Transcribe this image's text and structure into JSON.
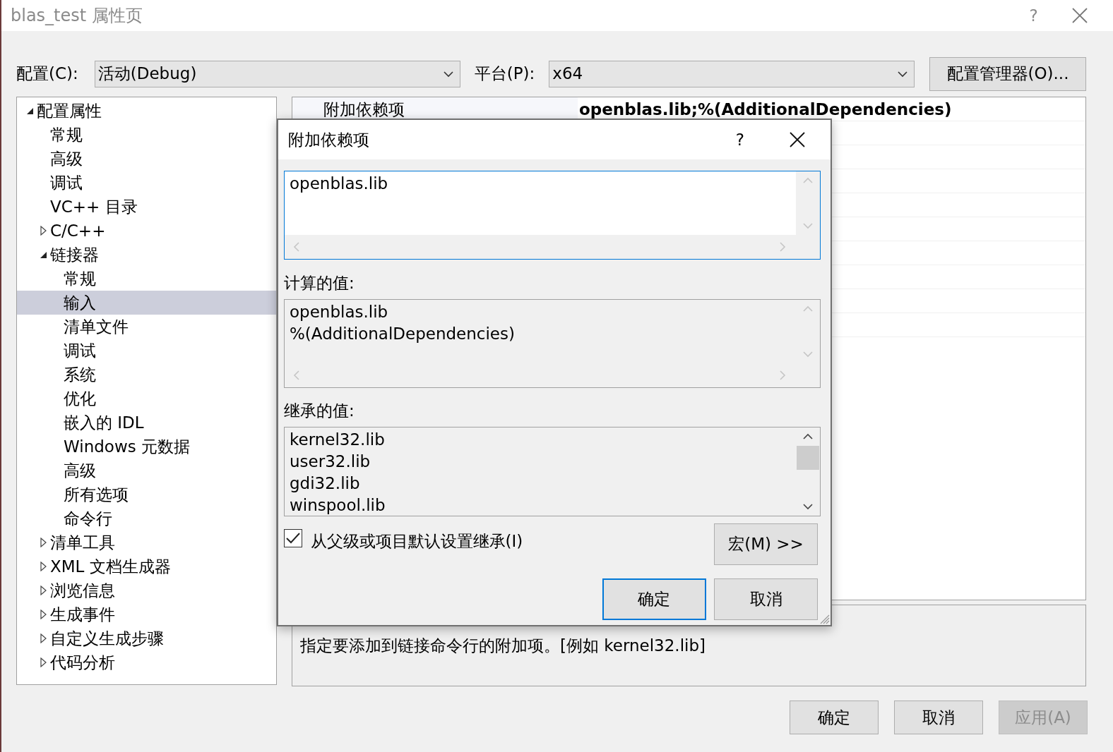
{
  "window": {
    "title": "blas_test 属性页",
    "help": "?"
  },
  "config": {
    "config_label": "配置(C):",
    "config_value": "活动(Debug)",
    "platform_label": "平台(P):",
    "platform_value": "x64",
    "manager_button": "配置管理器(O)..."
  },
  "tree": [
    {
      "label": "配置属性",
      "expanded": true,
      "selected": false,
      "children": [
        {
          "label": "常规",
          "selected": false
        },
        {
          "label": "高级",
          "selected": false
        },
        {
          "label": "调试",
          "selected": false
        },
        {
          "label": "VC++ 目录",
          "selected": false
        },
        {
          "label": "C/C++",
          "expanded": false,
          "selected": false
        },
        {
          "label": "链接器",
          "expanded": true,
          "selected": false,
          "children": [
            {
              "label": "常规",
              "selected": false
            },
            {
              "label": "输入",
              "selected": true
            },
            {
              "label": "清单文件",
              "selected": false
            },
            {
              "label": "调试",
              "selected": false
            },
            {
              "label": "系统",
              "selected": false
            },
            {
              "label": "优化",
              "selected": false
            },
            {
              "label": "嵌入的 IDL",
              "selected": false
            },
            {
              "label": "Windows 元数据",
              "selected": false
            },
            {
              "label": "高级",
              "selected": false
            },
            {
              "label": "所有选项",
              "selected": false
            },
            {
              "label": "命令行",
              "selected": false
            }
          ]
        },
        {
          "label": "清单工具",
          "expanded": false,
          "selected": false
        },
        {
          "label": "XML 文档生成器",
          "expanded": false,
          "selected": false
        },
        {
          "label": "浏览信息",
          "expanded": false,
          "selected": false
        },
        {
          "label": "生成事件",
          "expanded": false,
          "selected": false
        },
        {
          "label": "自定义生成步骤",
          "expanded": false,
          "selected": false
        },
        {
          "label": "代码分析",
          "expanded": false,
          "selected": false
        }
      ]
    }
  ],
  "grid": {
    "rows": [
      {
        "name": "附加依赖项",
        "value": "openblas.lib;%(AdditionalDependencies)"
      }
    ]
  },
  "description": "指定要添加到链接命令行的附加项。[例如 kernel32.lib]",
  "buttons": [
    {
      "label": "确定",
      "disabled": false
    },
    {
      "label": "取消",
      "disabled": false
    },
    {
      "label": "应用(A)",
      "disabled": true
    }
  ],
  "dialog": {
    "title": "附加依赖项",
    "help": "?",
    "edit_value": "openblas.lib",
    "evaluated_label": "计算的值:",
    "evaluated_lines": [
      "openblas.lib",
      "%(AdditionalDependencies)"
    ],
    "inherited_label": "继承的值:",
    "inherited_lines": [
      "kernel32.lib",
      "user32.lib",
      "gdi32.lib",
      "winspool.lib"
    ],
    "inherit_checkbox": {
      "label": "从父级或项目默认设置继承(I)",
      "checked": true
    },
    "macros_button": "宏(M) >>",
    "buttons": [
      {
        "label": "确定",
        "default": true
      },
      {
        "label": "取消",
        "default": false
      }
    ]
  }
}
